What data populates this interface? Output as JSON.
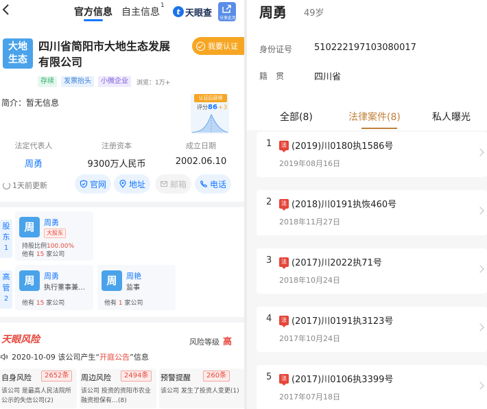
{
  "left": {
    "tabs": [
      {
        "label": "官方信息",
        "active": true
      },
      {
        "label": "自主信息",
        "badge": "1"
      }
    ],
    "brand": {
      "mark": "t",
      "name": "天眼查"
    },
    "share_label": "分享此页",
    "company": {
      "logo_line1": "大地",
      "logo_line2": "生态",
      "name_line1": "四川省简阳市大地生态发展",
      "name_line2": "有限公司",
      "verify_label": "我要认证"
    },
    "tags": [
      "存续",
      "发票抬头",
      "小微企业"
    ],
    "views": "浏览：1万+",
    "intro": "简介：暂无信息",
    "score": {
      "badge": "认证后获得",
      "label": "评分",
      "value": "86",
      "plus": "+3"
    },
    "info": [
      {
        "label": "法定代表人",
        "value": "周勇",
        "link": true
      },
      {
        "label": "注册资本",
        "value": "9300万人民币",
        "link": false
      },
      {
        "label": "成立日期",
        "value": "2002.06.10",
        "link": false
      }
    ],
    "updated": "1天前更新",
    "actions": [
      {
        "label": "官网",
        "icon": "shield-icon",
        "enabled": true
      },
      {
        "label": "地址",
        "icon": "location-icon",
        "enabled": true
      },
      {
        "label": "邮箱",
        "icon": "mail-icon",
        "enabled": false
      },
      {
        "label": "电话",
        "icon": "phone-icon",
        "enabled": true
      }
    ],
    "shareholders": {
      "side_label_1": "股",
      "side_label_2": "东",
      "count": "1",
      "person": {
        "avatar": "周",
        "name": "周勇",
        "badge": "大股东",
        "ratio_prefix": "持股比例",
        "ratio_value": "100.00%",
        "companies_prefix": "他有",
        "companies_count": "15",
        "companies_suffix": "家公司"
      }
    },
    "executives": {
      "side_label_1": "高",
      "side_label_2": "管",
      "count": "2",
      "people": [
        {
          "avatar": "周",
          "name": "周勇",
          "role": "执行董事兼…",
          "companies_prefix": "他有",
          "companies_count": "15",
          "companies_suffix": "家公司"
        },
        {
          "avatar": "周",
          "name": "周艳",
          "role": "监事",
          "companies_prefix": "他有",
          "companies_count": "1",
          "companies_suffix": "家公司"
        }
      ]
    },
    "risk": {
      "brand": "天眼风险",
      "level_label": "风险等级",
      "level_value": "高",
      "notice_prefix": "2020-10-09 该公司产生“",
      "notice_highlight": "开庭公告",
      "notice_suffix": "”信息",
      "cards": [
        {
          "title": "自身风险",
          "count": "2652条",
          "desc": "该公司 是最高人民法院所公示的失信公司(2)"
        },
        {
          "title": "周边风险",
          "count": "2494条",
          "desc": "该公司 投资的资阳市农业融资担保有…(8)"
        },
        {
          "title": "预警提醒",
          "count": "260条",
          "desc": "该公司 发生了投资人变更(1)"
        }
      ]
    }
  },
  "right": {
    "name": "周勇",
    "age": "49岁",
    "id_label": "身份证号",
    "id_value": "510222197103080017",
    "origin_label": "籍　贯",
    "origin_value": "四川省",
    "tabs": [
      {
        "label": "全部(8)",
        "active": false
      },
      {
        "label": "法律案件(8)",
        "active": true
      },
      {
        "label": "私人曝光",
        "active": false
      }
    ],
    "cases": [
      {
        "index": "1",
        "icon": "法",
        "code": "(2019)川0180执1586号",
        "date": "2019年08月16日"
      },
      {
        "index": "2",
        "icon": "法",
        "code": "(2018)川0191执恢460号",
        "date": "2018年11月27日"
      },
      {
        "index": "3",
        "icon": "法",
        "code": "(2017)川2022执71号",
        "date": "2018年10月24日"
      },
      {
        "index": "4",
        "icon": "法",
        "code": "(2017)川0191执3123号",
        "date": "2017年10月24日"
      },
      {
        "index": "5",
        "icon": "法",
        "code": "(2017)川0106执3399号",
        "date": "2017年07月18日"
      }
    ]
  }
}
